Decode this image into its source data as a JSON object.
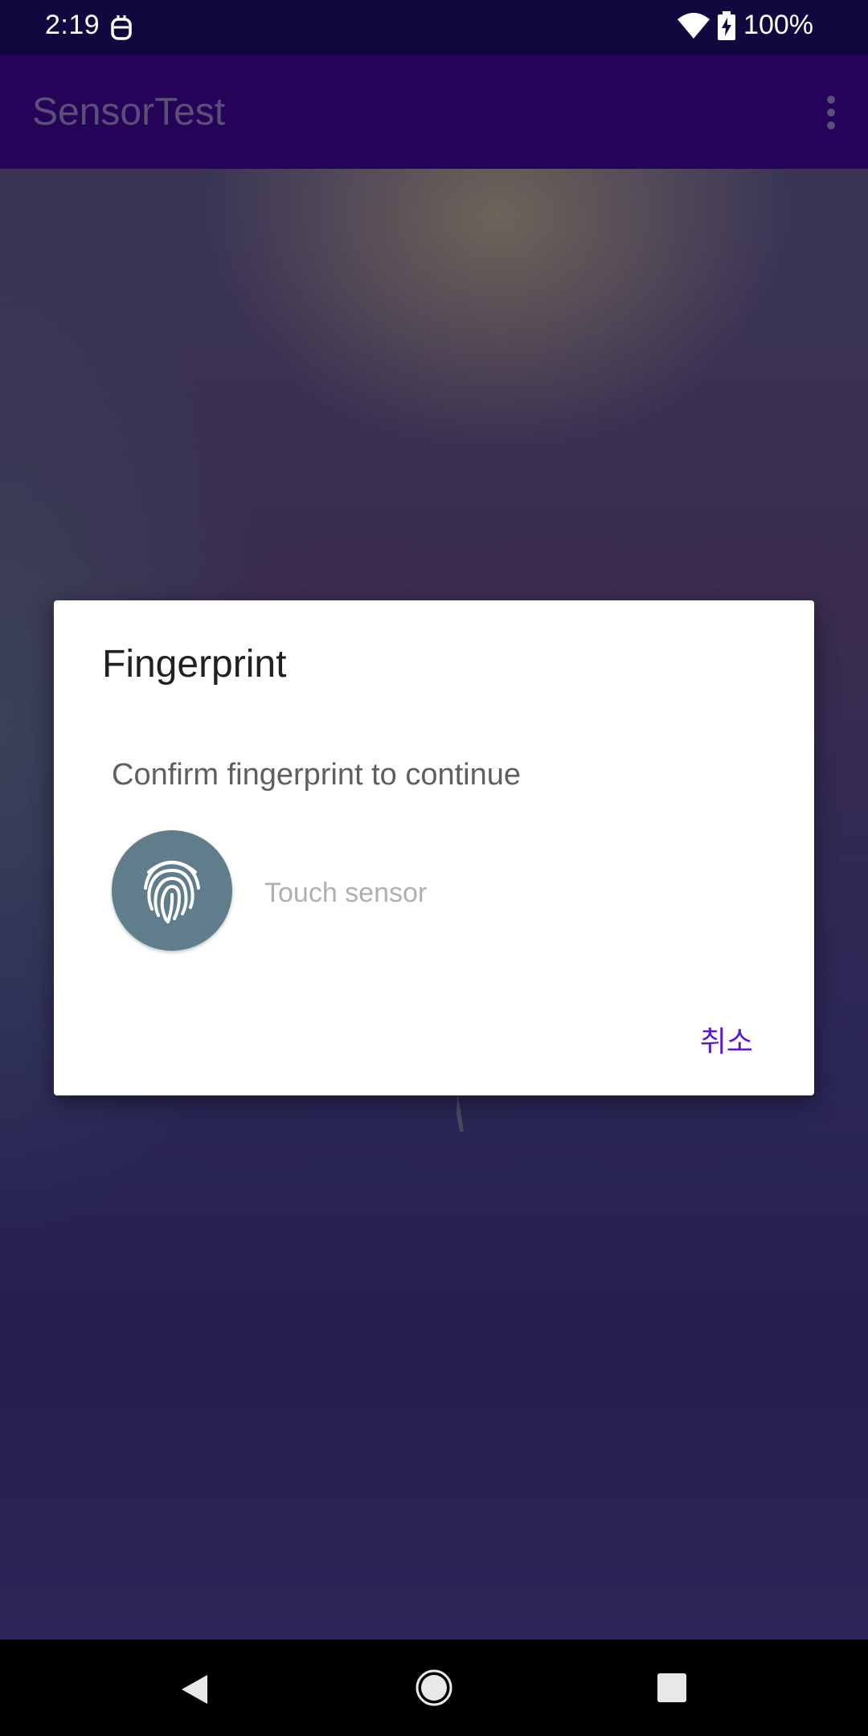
{
  "status_bar": {
    "time": "2:19",
    "battery": "100%",
    "icons": [
      "notification-icon",
      "wifi-icon",
      "battery-charging-icon"
    ]
  },
  "app_bar": {
    "title": "SensorTest",
    "menu_icon": "overflow-menu-icon"
  },
  "dialog": {
    "title": "Fingerprint",
    "description": "Confirm fingerprint to continue",
    "icon": "fingerprint-icon",
    "status": "Touch sensor",
    "cancel_label": "취소"
  },
  "nav_bar": {
    "icons": [
      "back-icon",
      "home-icon",
      "recents-icon"
    ]
  },
  "colors": {
    "status_bar": "#12083f",
    "app_bar": "#240358",
    "fingerprint_circle": "#607d8b",
    "accent": "#5b19d6"
  }
}
